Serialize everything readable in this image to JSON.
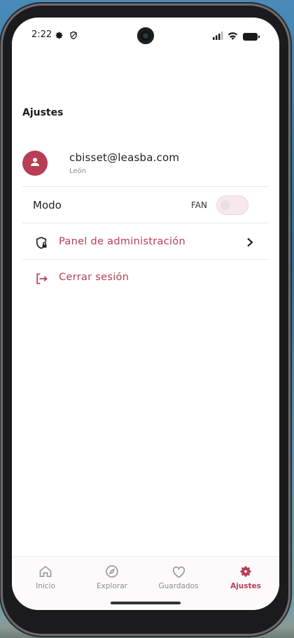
{
  "status_bar": {
    "time": "2:22",
    "icons": [
      "gear-icon",
      "shield-icon",
      "signal-icon",
      "wifi-icon",
      "battery-icon"
    ]
  },
  "page": {
    "title": "Ajustes"
  },
  "profile": {
    "email": "cbisset@leasba.com",
    "city": "León",
    "avatar_icon": "person-icon"
  },
  "mode": {
    "label": "Modo",
    "value_label": "FAN",
    "enabled": false
  },
  "menu": {
    "admin_label": "Panel de administración",
    "admin_icon": "shield-lock-icon",
    "logout_label": "Cerrar sesión",
    "logout_icon": "logout-icon"
  },
  "bottom_nav": {
    "items": [
      {
        "label": "Inicio",
        "icon": "home-icon"
      },
      {
        "label": "Explorar",
        "icon": "compass-icon"
      },
      {
        "label": "Guardados",
        "icon": "heart-icon"
      },
      {
        "label": "Ajustes",
        "icon": "gear-icon"
      }
    ],
    "active": "Ajustes"
  },
  "colors": {
    "accent": "#b93d55",
    "text": "#1f1f1f",
    "muted": "#8a8a8a",
    "divider": "#ebe7e8"
  }
}
